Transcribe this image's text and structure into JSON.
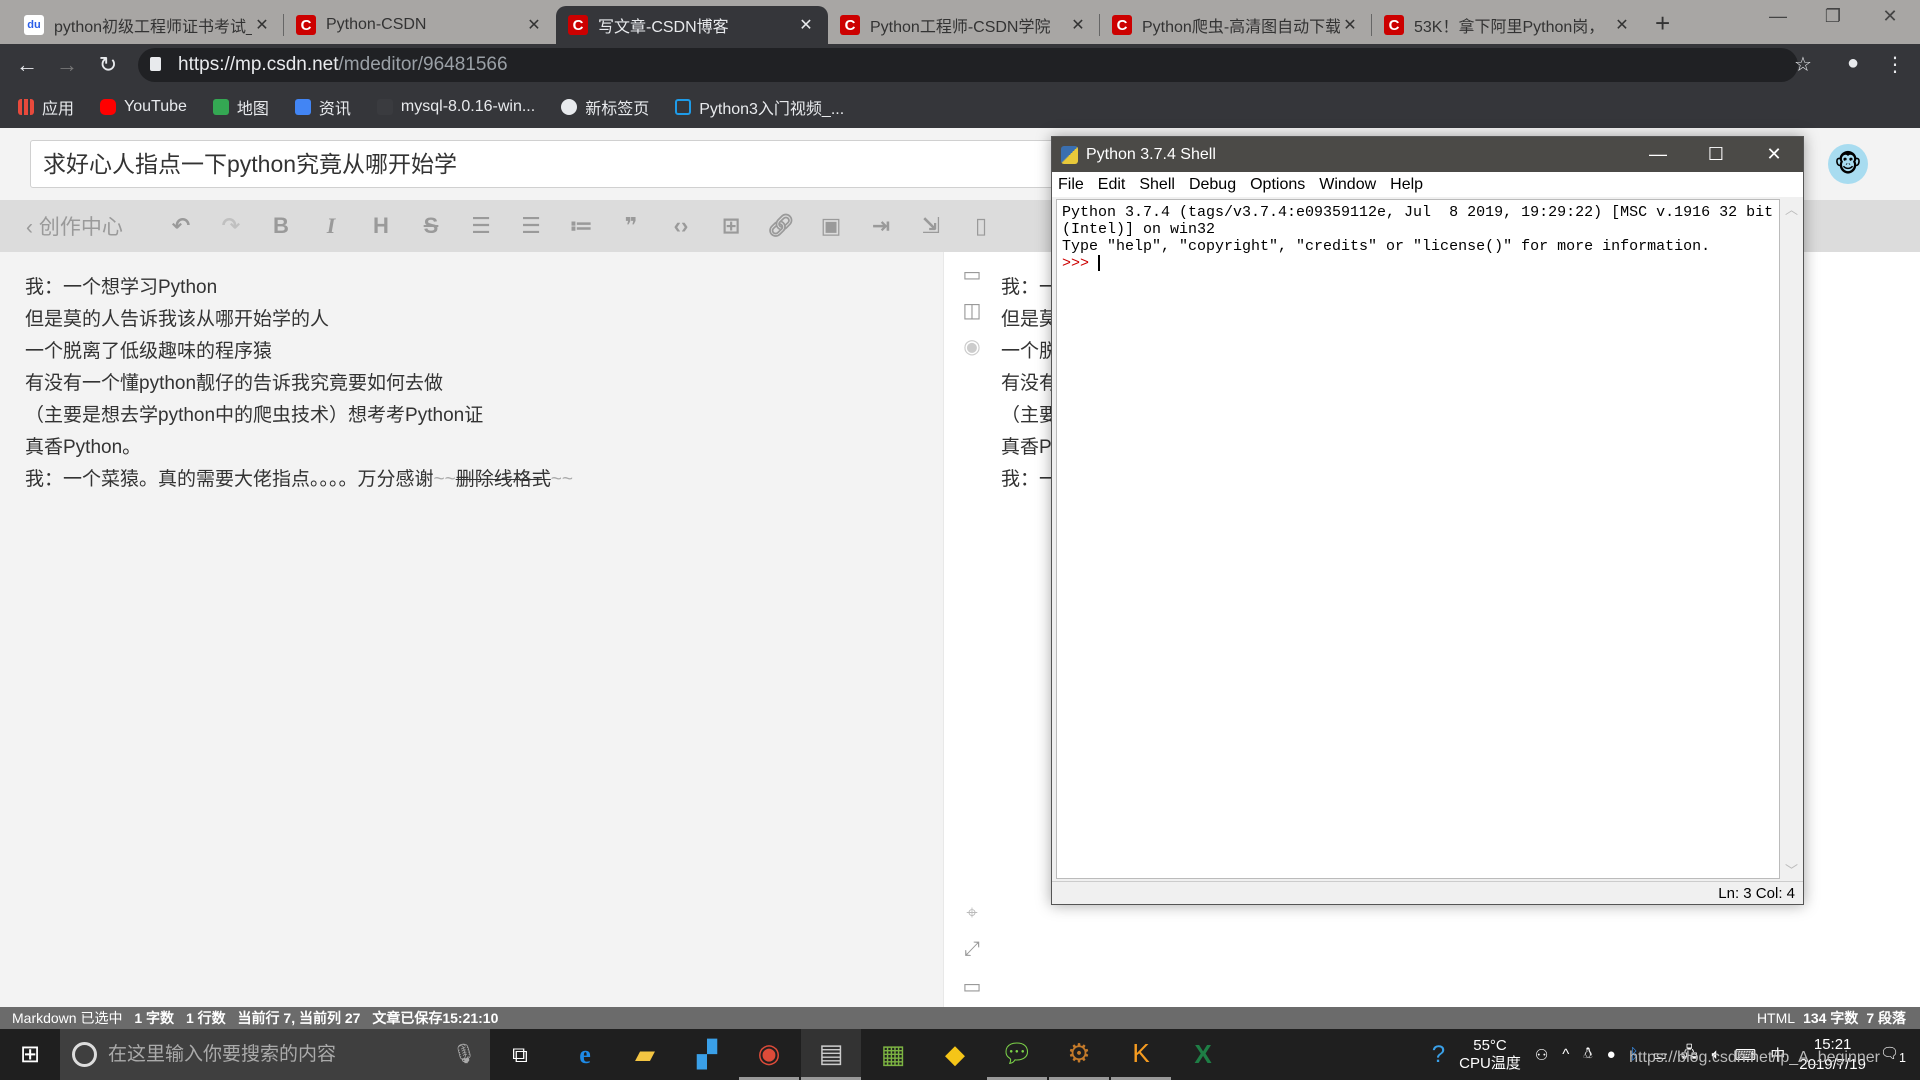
{
  "browser": {
    "tabs": [
      {
        "title": "python初级工程师证书考试_",
        "favicon": "baidu",
        "active": false
      },
      {
        "title": "Python-CSDN",
        "favicon": "csdn",
        "active": false
      },
      {
        "title": "写文章-CSDN博客",
        "favicon": "csdn",
        "active": true
      },
      {
        "title": "Python工程师-CSDN学院",
        "favicon": "csdn",
        "active": false
      },
      {
        "title": "Python爬虫-高清图自动下载",
        "favicon": "csdn",
        "active": false
      },
      {
        "title": "53K！拿下阿里Python岗，",
        "favicon": "csdn",
        "active": false
      }
    ],
    "url_host": "https://mp.csdn.net",
    "url_path": "/mdeditor/96481566",
    "bookmarks": [
      {
        "label": "应用",
        "color": "#e84a3c"
      },
      {
        "label": "YouTube",
        "color": "#ff0000"
      },
      {
        "label": "地图",
        "color": "#34a853"
      },
      {
        "label": "资讯",
        "color": "#4285f4"
      },
      {
        "label": "mysql-8.0.16-win...",
        "color": "#35363a"
      },
      {
        "label": "新标签页",
        "color": "#e8eaed"
      },
      {
        "label": "Python3入门视频_...",
        "color": "#1e9be8"
      }
    ]
  },
  "editor": {
    "title": "求好心人指点一下python究竟从哪开始学",
    "back_label": "创作中心",
    "toolbar_icons": [
      "undo-icon",
      "redo-icon",
      "bold-icon",
      "italic-icon",
      "heading-icon",
      "strikethrough-icon",
      "unordered-list-icon",
      "ordered-list-icon",
      "checklist-icon",
      "quote-icon",
      "code-icon",
      "table-icon",
      "link-icon",
      "image-icon",
      "import-icon",
      "export-icon",
      "catalog-icon"
    ],
    "lines": [
      "我：一个想学习Python",
      "但是莫的人告诉我该从哪开始学的人",
      "一个脱离了低级趣味的程序猿",
      "有没有一个懂python靓仔的告诉我究竟要如何去做",
      "（主要是想去学python中的爬虫技术）想考考Python证",
      "真香Python。",
      "我：一个菜猿。真的需要大佬指点。。。。万分感谢"
    ],
    "last_line_tilde": "~~",
    "last_line_strike": "删除线格式",
    "preview_lines": [
      "我：一",
      "但是莫",
      "一个脱",
      "有没有",
      "（主要",
      "真香P",
      "我：一"
    ],
    "status": {
      "mode": "Markdown",
      "selected": "已选中",
      "chars": "1 字数",
      "lines": "1 行数",
      "cursor": "当前行 7, 当前列 27",
      "saved": "文章已保存15:21:10",
      "right_mode": "HTML",
      "right_chars": "134 字数",
      "right_paras": "7 段落"
    }
  },
  "shell": {
    "title": "Python 3.7.4 Shell",
    "menu": [
      "File",
      "Edit",
      "Shell",
      "Debug",
      "Options",
      "Window",
      "Help"
    ],
    "output": "Python 3.7.4 (tags/v3.7.4:e09359112e, Jul  8 2019, 19:29:22) [MSC v.1916 32 bit\n(Intel)] on win32\nType \"help\", \"copyright\", \"credits\" or \"license()\" for more information.\n",
    "prompt": ">>> ",
    "status": "Ln: 3   Col: 4"
  },
  "taskbar": {
    "search_placeholder": "在这里输入你要搜索的内容",
    "temp": "55°C",
    "temp_label": "CPU温度",
    "time": "15:21",
    "date": "2019/7/19",
    "watermark": "https://blog.csdn.net/lp_A_beginner",
    "notification_count": "1"
  }
}
